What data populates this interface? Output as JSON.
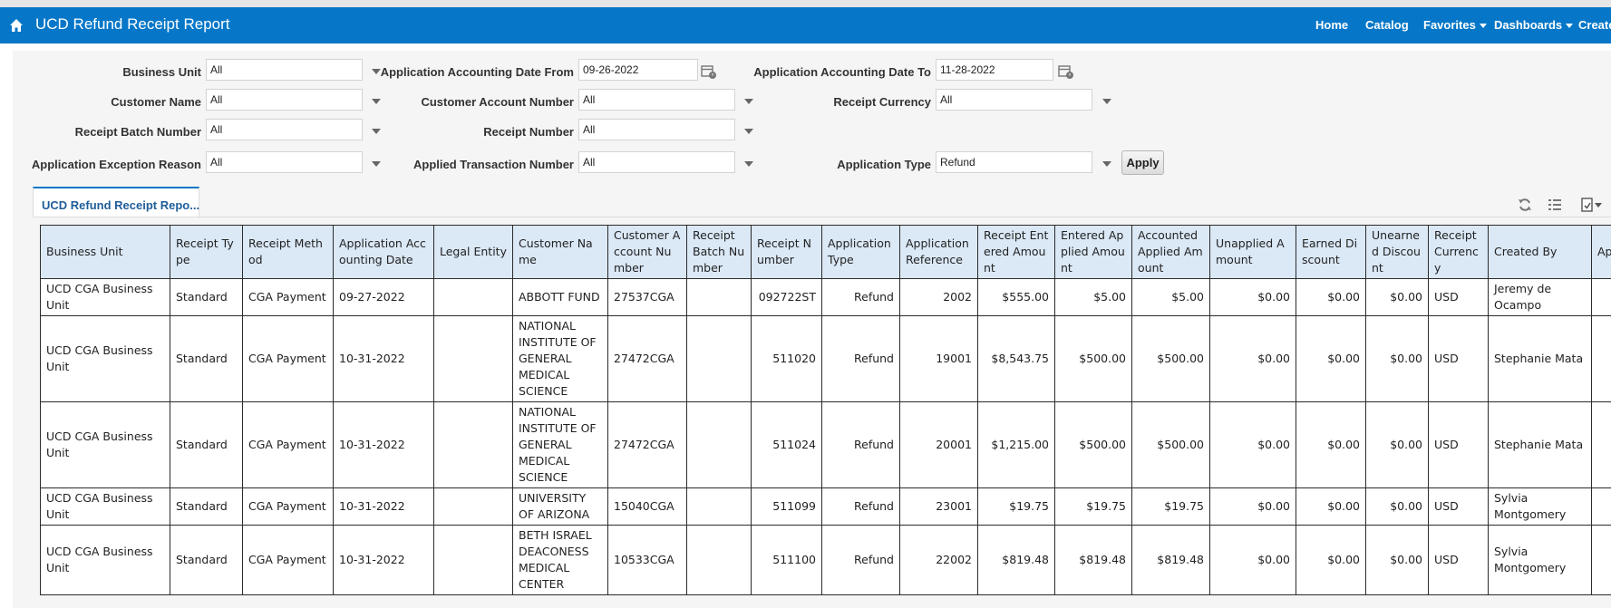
{
  "header": {
    "title": "UCD Refund Receipt Report",
    "nav": [
      "Home",
      "Catalog",
      "Favorites",
      "Dashboards",
      "Create"
    ]
  },
  "colors": {
    "header_bg": "#0677c8",
    "grid_header_bg": "#dbe8f6",
    "panel_bg": "#f5f5f5"
  },
  "filters": {
    "business_unit": {
      "label": "Business Unit",
      "value": "All"
    },
    "acct_date_from": {
      "label": "Application Accounting Date From",
      "value": "09-26-2022"
    },
    "acct_date_to": {
      "label": "Application Accounting Date To",
      "value": "11-28-2022"
    },
    "customer_name": {
      "label": "Customer Name",
      "value": "All"
    },
    "customer_account_number": {
      "label": "Customer Account Number",
      "value": "All"
    },
    "receipt_currency": {
      "label": "Receipt Currency",
      "value": "All"
    },
    "receipt_batch_number": {
      "label": "Receipt Batch Number",
      "value": "All"
    },
    "receipt_number": {
      "label": "Receipt Number",
      "value": "All"
    },
    "exception_reason": {
      "label": "Application Exception Reason",
      "value": "All"
    },
    "applied_transaction_number": {
      "label": "Applied Transaction Number",
      "value": "All"
    },
    "application_type": {
      "label": "Application Type",
      "value": "Refund"
    },
    "apply_label": "Apply"
  },
  "tab": {
    "label": "UCD Refund Receipt Repo..."
  },
  "table": {
    "columns": [
      "Business Unit",
      "Receipt Type",
      "Receipt Method",
      "Application Accounting Date",
      "Legal Entity",
      "Customer Name",
      "Customer Account Number",
      "Receipt Batch Number",
      "Receipt Number",
      "Application Type",
      "Application Reference",
      "Receipt Entered Amount",
      "Entered Applied Amount",
      "Accounted Applied Amount",
      "Unapplied Amount",
      "Earned Discount",
      "Unearned Discount",
      "Receipt Currency",
      "Created By",
      "Applied By"
    ],
    "rows": [
      [
        "UCD CGA Business Unit",
        "Standard",
        "CGA Payment",
        "09-27-2022",
        "",
        "ABBOTT FUND",
        "27537CGA",
        "",
        "092722ST",
        "Refund",
        "2002",
        "$555.00",
        "$5.00",
        "$5.00",
        "$0.00",
        "$0.00",
        "$0.00",
        "USD",
        "Jeremy de Ocampo",
        ""
      ],
      [
        "UCD CGA Business Unit",
        "Standard",
        "CGA Payment",
        "10-31-2022",
        "",
        "NATIONAL INSTITUTE OF GENERAL MEDICAL SCIENCE",
        "27472CGA",
        "",
        "511020",
        "Refund",
        "19001",
        "$8,543.75",
        "$500.00",
        "$500.00",
        "$0.00",
        "$0.00",
        "$0.00",
        "USD",
        "Stephanie Mata",
        ""
      ],
      [
        "UCD CGA Business Unit",
        "Standard",
        "CGA Payment",
        "10-31-2022",
        "",
        "NATIONAL INSTITUTE OF GENERAL MEDICAL SCIENCE",
        "27472CGA",
        "",
        "511024",
        "Refund",
        "20001",
        "$1,215.00",
        "$500.00",
        "$500.00",
        "$0.00",
        "$0.00",
        "$0.00",
        "USD",
        "Stephanie Mata",
        ""
      ],
      [
        "UCD CGA Business Unit",
        "Standard",
        "CGA Payment",
        "10-31-2022",
        "",
        "UNIVERSITY OF ARIZONA",
        "15040CGA",
        "",
        "511099",
        "Refund",
        "23001",
        "$19.75",
        "$19.75",
        "$19.75",
        "$0.00",
        "$0.00",
        "$0.00",
        "USD",
        "Sylvia Montgomery",
        ""
      ],
      [
        "UCD CGA Business Unit",
        "Standard",
        "CGA Payment",
        "10-31-2022",
        "",
        "BETH ISRAEL DEACONESS MEDICAL CENTER",
        "10533CGA",
        "",
        "511100",
        "Refund",
        "22002",
        "$819.48",
        "$819.48",
        "$819.48",
        "$0.00",
        "$0.00",
        "$0.00",
        "USD",
        "Sylvia Montgomery",
        ""
      ]
    ]
  }
}
